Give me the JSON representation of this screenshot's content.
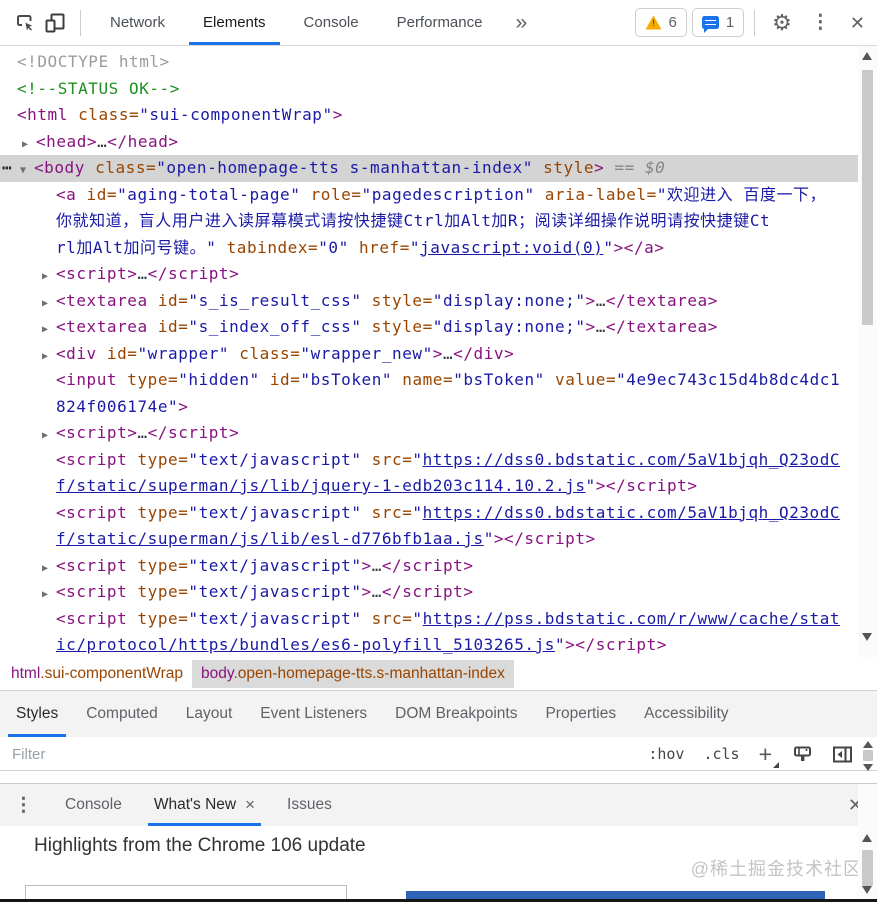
{
  "toolbar": {
    "tabs": [
      "Network",
      "Elements",
      "Console",
      "Performance"
    ],
    "active_tab": "Elements",
    "overflow_symbol": "»",
    "warning_count": "6",
    "message_count": "1"
  },
  "colors": {
    "accent": "#1a73e8",
    "warning": "#f9ab00",
    "tag": "#881280",
    "attribute": "#994500",
    "value": "#1a1aa6",
    "comment": "#1f8f1f",
    "selected_row": "#d4d4d4"
  },
  "dom_tree": {
    "lines": [
      {
        "lv": "r",
        "seg": [
          [
            "d",
            "<!DOCTYPE html>"
          ]
        ]
      },
      {
        "lv": "r",
        "seg": [
          [
            "c",
            "<!--STATUS OK-->"
          ]
        ]
      },
      {
        "lv": "r",
        "seg": [
          [
            "t",
            "<html"
          ],
          [
            "a",
            " class="
          ],
          [
            "v",
            "\"sui-componentWrap\""
          ],
          [
            "t",
            ">"
          ]
        ]
      },
      {
        "lv": "h",
        "ar": "c",
        "seg": [
          [
            "t",
            "<head>"
          ],
          [
            "e",
            "…"
          ],
          [
            "t",
            "</head>"
          ]
        ]
      },
      {
        "lv": "b",
        "ar": "e",
        "dots": true,
        "sel": true,
        "seg": [
          [
            "t",
            "<body"
          ],
          [
            "a",
            " class="
          ],
          [
            "v",
            "\"open-homepage-tts s-manhattan-index\""
          ],
          [
            "a",
            " style"
          ],
          [
            "t",
            ">"
          ],
          [
            "g",
            " == $0"
          ]
        ]
      },
      {
        "lv": "c",
        "seg": [
          [
            "t",
            "<a"
          ],
          [
            "a",
            " id="
          ],
          [
            "v",
            "\"aging-total-page\""
          ],
          [
            "a",
            " role="
          ],
          [
            "v",
            "\"pagedescription\""
          ],
          [
            "a",
            " aria-label="
          ],
          [
            "v",
            "\"欢迎进入 百度一下，"
          ]
        ]
      },
      {
        "lv": "w",
        "seg": [
          [
            "v",
            "你就知道，盲人用户进入读屏幕模式请按快捷键Ctrl加Alt加R；阅读详细操作说明请按快捷键Ct"
          ]
        ]
      },
      {
        "lv": "w",
        "seg": [
          [
            "v",
            "rl加Alt加问号键。\""
          ],
          [
            "a",
            " tabindex="
          ],
          [
            "v",
            "\"0\""
          ],
          [
            "a",
            " href="
          ],
          [
            "v",
            "\""
          ],
          [
            "l",
            "javascript:void(0)"
          ],
          [
            "v",
            "\""
          ],
          [
            "t",
            "></a>"
          ]
        ]
      },
      {
        "lv": "c",
        "ar": "c",
        "seg": [
          [
            "t",
            "<script>"
          ],
          [
            "e",
            "…"
          ],
          [
            "t",
            "</script>"
          ]
        ]
      },
      {
        "lv": "c",
        "ar": "c",
        "seg": [
          [
            "t",
            "<textarea"
          ],
          [
            "a",
            " id="
          ],
          [
            "v",
            "\"s_is_result_css\""
          ],
          [
            "a",
            " style="
          ],
          [
            "v",
            "\"display:none;\""
          ],
          [
            "t",
            ">"
          ],
          [
            "e",
            "…"
          ],
          [
            "t",
            "</textarea>"
          ]
        ]
      },
      {
        "lv": "c",
        "ar": "c",
        "seg": [
          [
            "t",
            "<textarea"
          ],
          [
            "a",
            " id="
          ],
          [
            "v",
            "\"s_index_off_css\""
          ],
          [
            "a",
            " style="
          ],
          [
            "v",
            "\"display:none;\""
          ],
          [
            "t",
            ">"
          ],
          [
            "e",
            "…"
          ],
          [
            "t",
            "</textarea>"
          ]
        ]
      },
      {
        "lv": "c",
        "ar": "c",
        "seg": [
          [
            "t",
            "<div"
          ],
          [
            "a",
            " id="
          ],
          [
            "v",
            "\"wrapper\""
          ],
          [
            "a",
            " class="
          ],
          [
            "v",
            "\"wrapper_new\""
          ],
          [
            "t",
            ">"
          ],
          [
            "e",
            "…"
          ],
          [
            "t",
            "</div>"
          ]
        ]
      },
      {
        "lv": "c",
        "seg": [
          [
            "t",
            "<input"
          ],
          [
            "a",
            " type="
          ],
          [
            "v",
            "\"hidden\""
          ],
          [
            "a",
            " id="
          ],
          [
            "v",
            "\"bsToken\""
          ],
          [
            "a",
            " name="
          ],
          [
            "v",
            "\"bsToken\""
          ],
          [
            "a",
            " value="
          ],
          [
            "v",
            "\"4e9ec743c15d4b8dc4dc1"
          ]
        ]
      },
      {
        "lv": "w",
        "seg": [
          [
            "v",
            "824f006174e\""
          ],
          [
            "t",
            ">"
          ]
        ]
      },
      {
        "lv": "c",
        "ar": "c",
        "seg": [
          [
            "t",
            "<script>"
          ],
          [
            "e",
            "…"
          ],
          [
            "t",
            "</script>"
          ]
        ]
      },
      {
        "lv": "c",
        "seg": [
          [
            "t",
            "<script"
          ],
          [
            "a",
            " type="
          ],
          [
            "v",
            "\"text/javascript\""
          ],
          [
            "a",
            " src="
          ],
          [
            "v",
            "\""
          ],
          [
            "l",
            "https://dss0.bdstatic.com/5aV1bjqh_Q23odC"
          ]
        ]
      },
      {
        "lv": "w",
        "seg": [
          [
            "l",
            "f/static/superman/js/lib/jquery-1-edb203c114.10.2.js"
          ],
          [
            "v",
            "\""
          ],
          [
            "t",
            "></script>"
          ]
        ]
      },
      {
        "lv": "c",
        "seg": [
          [
            "t",
            "<script"
          ],
          [
            "a",
            " type="
          ],
          [
            "v",
            "\"text/javascript\""
          ],
          [
            "a",
            " src="
          ],
          [
            "v",
            "\""
          ],
          [
            "l",
            "https://dss0.bdstatic.com/5aV1bjqh_Q23odC"
          ]
        ]
      },
      {
        "lv": "w",
        "seg": [
          [
            "l",
            "f/static/superman/js/lib/esl-d776bfb1aa.js"
          ],
          [
            "v",
            "\""
          ],
          [
            "t",
            "></script>"
          ]
        ]
      },
      {
        "lv": "c",
        "ar": "c",
        "seg": [
          [
            "t",
            "<script"
          ],
          [
            "a",
            " type="
          ],
          [
            "v",
            "\"text/javascript\""
          ],
          [
            "t",
            ">"
          ],
          [
            "e",
            "…"
          ],
          [
            "t",
            "</script>"
          ]
        ]
      },
      {
        "lv": "c",
        "ar": "c",
        "seg": [
          [
            "t",
            "<script"
          ],
          [
            "a",
            " type="
          ],
          [
            "v",
            "\"text/javascript\""
          ],
          [
            "t",
            ">"
          ],
          [
            "e",
            "…"
          ],
          [
            "t",
            "</script>"
          ]
        ]
      },
      {
        "lv": "c",
        "seg": [
          [
            "t",
            "<script"
          ],
          [
            "a",
            " type="
          ],
          [
            "v",
            "\"text/javascript\""
          ],
          [
            "a",
            " src="
          ],
          [
            "v",
            "\""
          ],
          [
            "l",
            "https://pss.bdstatic.com/r/www/cache/stat"
          ]
        ]
      },
      {
        "lv": "w",
        "seg": [
          [
            "l",
            "ic/protocol/https/bundles/es6-polyfill_5103265.js"
          ],
          [
            "v",
            "\""
          ],
          [
            "t",
            "></script>"
          ]
        ]
      }
    ]
  },
  "breadcrumbs": [
    {
      "tag": "html",
      "classes": ".sui-componentWrap",
      "selected": false
    },
    {
      "tag": "body",
      "classes": ".open-homepage-tts.s-manhattan-index",
      "selected": true
    }
  ],
  "styles_pane": {
    "tabs": [
      "Styles",
      "Computed",
      "Layout",
      "Event Listeners",
      "DOM Breakpoints",
      "Properties",
      "Accessibility"
    ],
    "active_tab": "Styles",
    "filter_placeholder": "Filter",
    "pseudo_toggle": ":hov",
    "class_toggle": ".cls",
    "new_rule": "+"
  },
  "drawer": {
    "tabs": [
      "Console",
      "What's New",
      "Issues"
    ],
    "active_tab": "What's New",
    "tab_close": "×",
    "heading": "Highlights from the Chrome 106 update"
  },
  "watermark": "@稀土掘金技术社区"
}
